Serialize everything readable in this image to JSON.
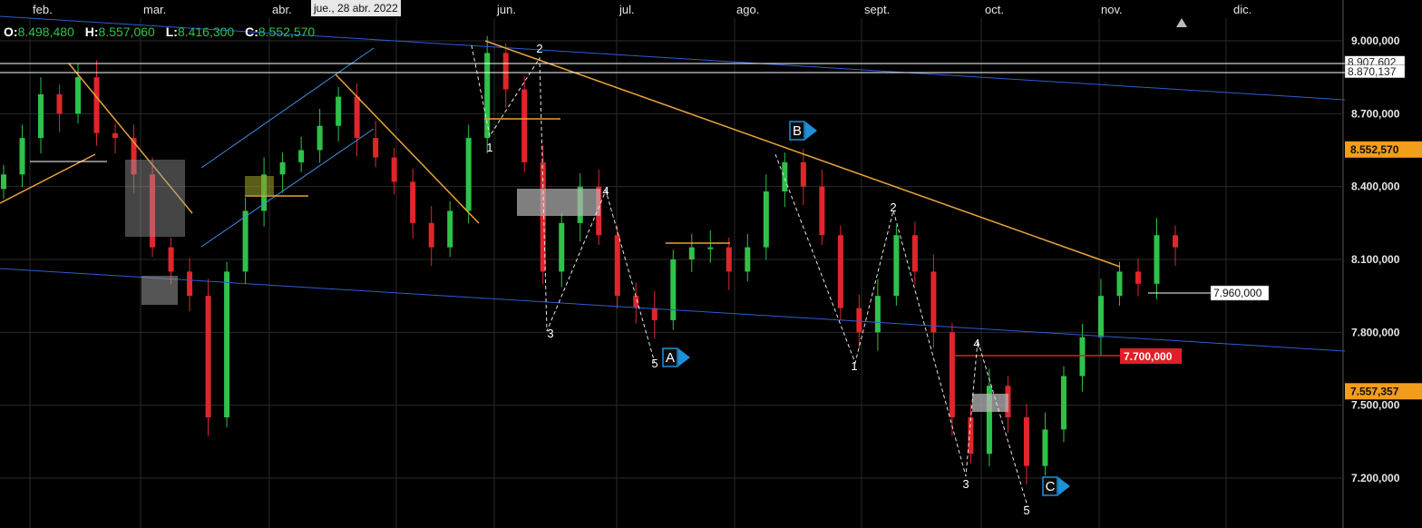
{
  "header": {
    "cursor_date": "jue., 28 abr. 2022",
    "ohlc": {
      "o_label": "O:",
      "o_value": "8.498,480",
      "h_label": "H:",
      "h_value": "8.557,060",
      "l_label": "L:",
      "l_value": "8.416,300",
      "c_label": "C:",
      "c_value": "8.552,570"
    }
  },
  "months": [
    "feb.",
    "mar.",
    "abr.",
    "jun.",
    "jul.",
    "ago.",
    "sept.",
    "oct.",
    "nov.",
    "dic."
  ],
  "colors": {
    "bull": "#2ec24a",
    "bear": "#e0262b",
    "trendline_orange": "#e8a33c",
    "channel_blue": "#2f5cd6",
    "channel_lightblue": "#3f8ee0",
    "wave_marker": "#1e90d8",
    "price_tag_orange": "#f29d1b",
    "price_tag_red": "#e01f26"
  },
  "annotations": {
    "wave_labels": [
      "1",
      "2",
      "3",
      "4",
      "5",
      "1",
      "2",
      "3",
      "4",
      "5"
    ],
    "corrective_labels": [
      "A",
      "B",
      "C"
    ],
    "level_tags": {
      "level_7960": "7.960,000",
      "level_7700": "7.700,000"
    }
  },
  "chart_data": {
    "type": "candlestick",
    "title": "",
    "xlabel": "",
    "ylabel": "",
    "y_ticks": [
      7200000,
      7500000,
      7800000,
      8100000,
      8400000,
      8700000,
      9000000
    ],
    "y_tick_labels": [
      "7.200,000",
      "7.500,000",
      "7.800,000",
      "8.100,000",
      "8.400,000",
      "8.700,000",
      "9.000,000"
    ],
    "ylim": [
      7000000,
      9150000
    ],
    "x_months": [
      "feb.",
      "mar.",
      "abr.",
      "jun.",
      "jul.",
      "ago.",
      "sept.",
      "oct.",
      "nov.",
      "dic."
    ],
    "price_tags": [
      {
        "label": "8.907,602",
        "value": 8907602,
        "style": "white-line"
      },
      {
        "label": "8.870,137",
        "value": 8870137,
        "style": "white-line"
      },
      {
        "label": "8.552,570",
        "value": 8552570,
        "style": "orange"
      },
      {
        "label": "7.557,357",
        "value": 7557357,
        "style": "orange"
      }
    ],
    "horizontal_levels": [
      7960000,
      7700000
    ],
    "series_close_approx": [
      8450000,
      8600000,
      8780000,
      8700000,
      8850000,
      8620000,
      8600000,
      8450000,
      8150000,
      8050000,
      7950000,
      7450000,
      8050000,
      8300000,
      8450000,
      8500000,
      8550000,
      8650000,
      8770000,
      8600000,
      8520000,
      8420000,
      8250000,
      8150000,
      8300000,
      8600000,
      8950000,
      8800000,
      8500000,
      8050000,
      8250000,
      8400000,
      8200000,
      7950000,
      7900000,
      7850000,
      8100000,
      8150000,
      8150000,
      8050000,
      8150000,
      8380000,
      8500000,
      8400000,
      8200000,
      7900000,
      7800000,
      7950000,
      8200000,
      8050000,
      7800000,
      7450000,
      7300000,
      7580000,
      7450000,
      7250000,
      7400000,
      7620000,
      7780000,
      7950000,
      8050000,
      8000000,
      8200000,
      8150000
    ]
  }
}
